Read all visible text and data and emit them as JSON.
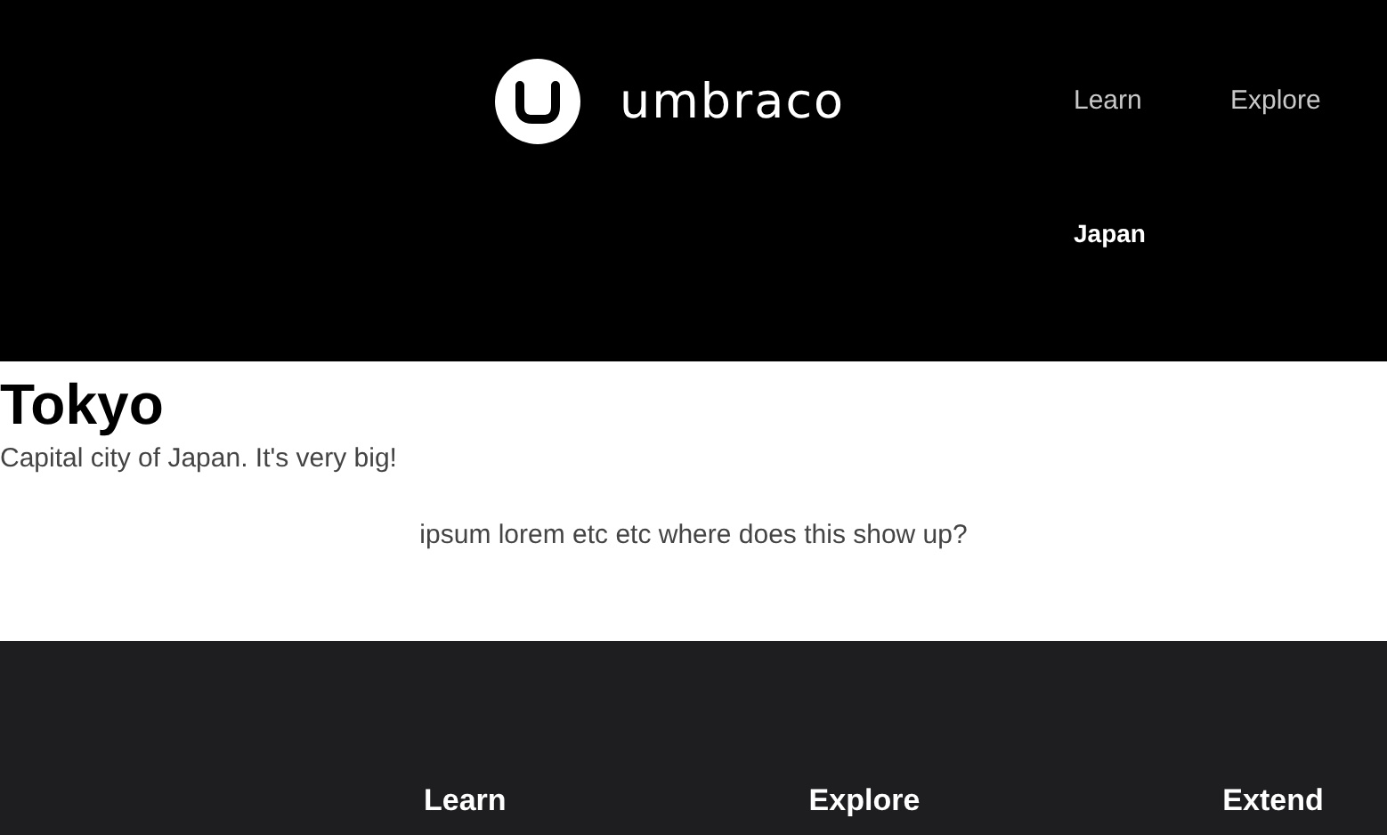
{
  "header": {
    "logo": {
      "text": "umbraco"
    },
    "nav": [
      {
        "label": "Learn",
        "selected": false
      },
      {
        "label": "Explore",
        "selected": false
      },
      {
        "label": "Japan",
        "selected": true
      }
    ]
  },
  "content": {
    "title": "Tokyo",
    "subtitle": "Capital city of Japan. It's very big!",
    "body": "ipsum lorem etc etc where does this show up?"
  },
  "footer": {
    "headings": [
      "Learn",
      "Explore",
      "Extend"
    ]
  }
}
